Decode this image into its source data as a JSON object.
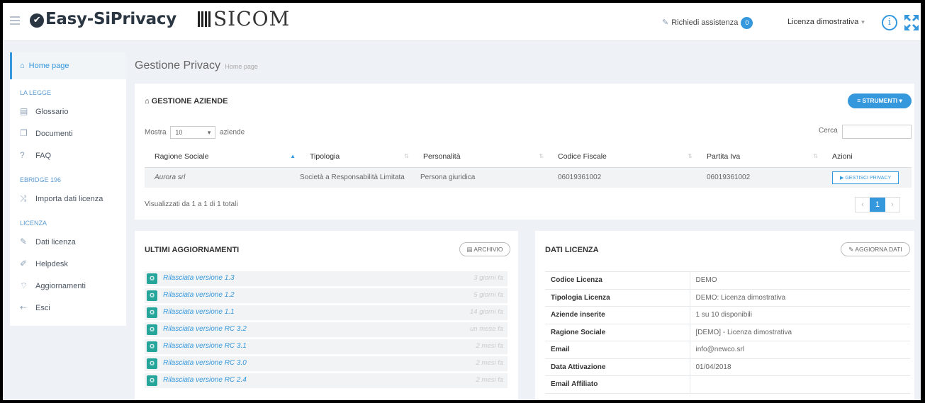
{
  "header": {
    "brand": "Easy-SiPrivacy",
    "partner": "SICOM",
    "assist_label": "Richiedi assistenza",
    "assist_count": "0",
    "license_label": "Licenza dimostrativa"
  },
  "sidebar": {
    "home": "Home page",
    "sections": [
      {
        "title": "LA LEGGE",
        "items": [
          "Glossario",
          "Documenti",
          "FAQ"
        ]
      },
      {
        "title": "EBRIDGE 196",
        "items": [
          "Importa dati licenza"
        ]
      },
      {
        "title": "LICENZA",
        "items": [
          "Dati licenza",
          "Helpdesk",
          "Aggiornamenti",
          "Esci"
        ]
      }
    ]
  },
  "page": {
    "title": "Gestione Privacy",
    "subtitle": "Home page"
  },
  "aziende": {
    "title": "GESTIONE AZIENDE",
    "tools_btn": "STRUMENTI",
    "show_label": "Mostra",
    "show_value": "10",
    "show_suffix": "aziende",
    "search_label": "Cerca",
    "columns": [
      "Ragione Sociale",
      "Tipologia",
      "Personalità",
      "Codice Fiscale",
      "Partita Iva",
      "Azioni"
    ],
    "rows": [
      {
        "ragione": "Aurora srl",
        "tipologia": "Società a Responsabilità Limitata",
        "personalita": "Persona giuridica",
        "cf": "06019361002",
        "piva": "06019361002",
        "action": "GESTISCI PRIVACY"
      }
    ],
    "footer": "Visualizzati da 1 a 1 di 1 totali",
    "page_current": "1"
  },
  "updates": {
    "title": "ULTIMI AGGIORNAMENTI",
    "archive_btn": "ARCHIVIO",
    "items": [
      {
        "label": "Rilasciata versione 1.3",
        "date": "3 giorni fa"
      },
      {
        "label": "Rilasciata versione 1.2",
        "date": "5 giorni fa"
      },
      {
        "label": "Rilasciata versione 1.1",
        "date": "14 giorni fa"
      },
      {
        "label": "Rilasciata versione RC 3.2",
        "date": "un mese fa"
      },
      {
        "label": "Rilasciata versione RC 3.1",
        "date": "2 mesi fa"
      },
      {
        "label": "Rilasciata versione RC 3.0",
        "date": "2 mesi fa"
      },
      {
        "label": "Rilasciata versione RC 2.4",
        "date": "2 mesi fa"
      }
    ]
  },
  "license": {
    "title": "DATI LICENZA",
    "update_btn": "AGGIORNA DATI",
    "rows": [
      {
        "k": "Codice Licenza",
        "v": "DEMO"
      },
      {
        "k": "Tipologia Licenza",
        "v": "DEMO: Licenza dimostrativa"
      },
      {
        "k": "Aziende inserite",
        "v": "1 su 10 disponibili"
      },
      {
        "k": "Ragione Sociale",
        "v": "[DEMO] - Licenza dimostrativa"
      },
      {
        "k": "Email",
        "v": "info@newco.srl"
      },
      {
        "k": "Data Attivazione",
        "v": "01/04/2018"
      },
      {
        "k": "Email Affiliato",
        "v": ""
      }
    ]
  }
}
